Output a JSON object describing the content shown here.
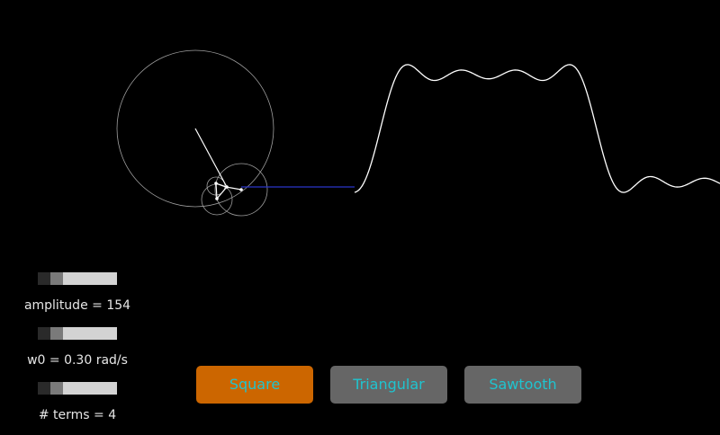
{
  "controls": {
    "amplitude": {
      "label": "amplitude = 154",
      "value": 154,
      "level": 0.2
    },
    "w0": {
      "label": "w0 = 0.30 rad/s",
      "value": 0.3,
      "level": 0.2
    },
    "terms": {
      "label": "# terms = 4",
      "value": 4,
      "level": 0.2
    }
  },
  "buttons": [
    {
      "label": "Square",
      "selected": true
    },
    {
      "label": "Triangular",
      "selected": false
    },
    {
      "label": "Sawtooth",
      "selected": false
    }
  ],
  "colors": {
    "background": "#000000",
    "selected_button": "#cc6600",
    "button": "#666666",
    "button_text": "#1fc4cf",
    "slider_track": "#d3d3d3",
    "slider_thumb": "#7a7a7a",
    "wave": "#ffffff",
    "circles": "#a0a0a0",
    "connector": "#2b35c8"
  }
}
